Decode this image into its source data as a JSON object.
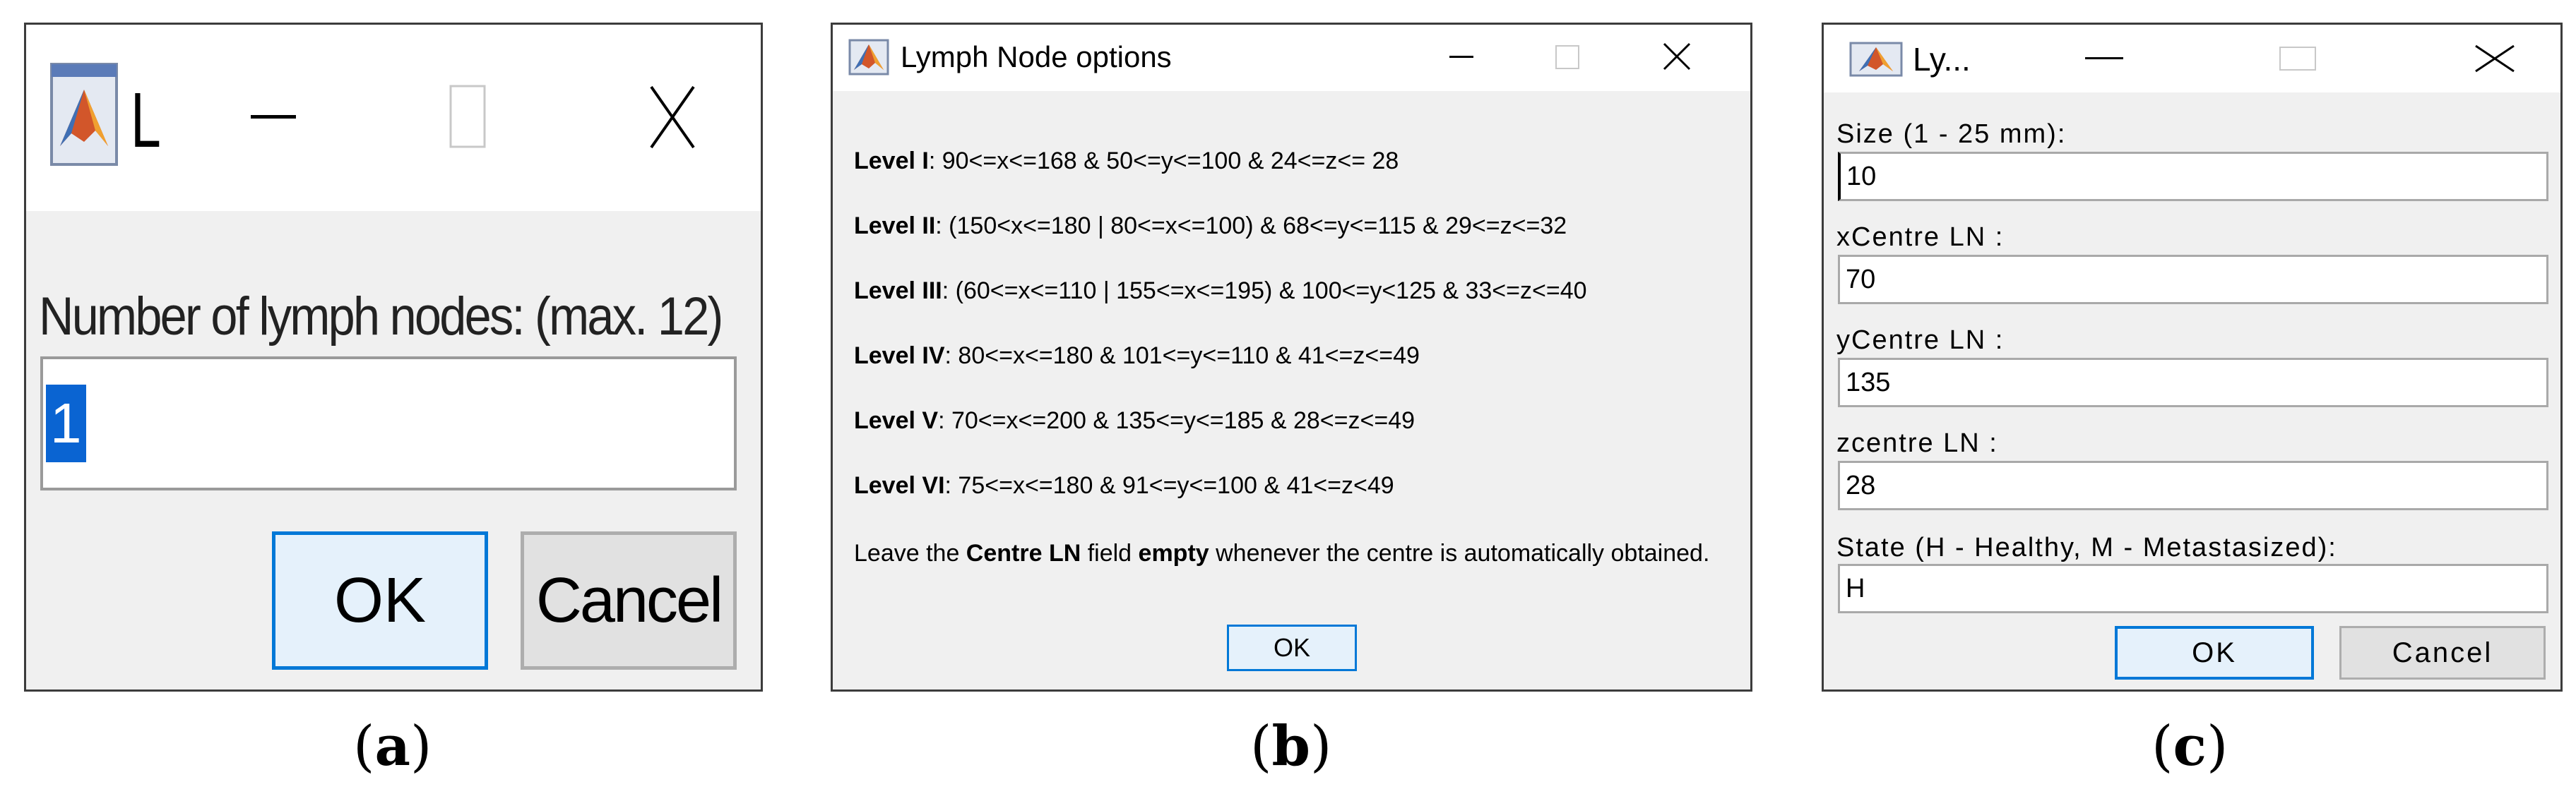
{
  "panel_a": {
    "title": "L",
    "prompt": "Number of lymph nodes: (max. 12)",
    "input_value": "1",
    "ok_label": "OK",
    "cancel_label": "Cancel",
    "caption": "a"
  },
  "panel_b": {
    "title": "Lymph Node options",
    "levels": [
      {
        "name": "Level I",
        "rule": ": 90<=x<=168 & 50<=y<=100 & 24<=z<= 28"
      },
      {
        "name": "Level II",
        "rule": ": (150<x<=180 | 80<=x<=100) & 68<=y<=115 & 29<=z<=32"
      },
      {
        "name": "Level III",
        "rule": ": (60<=x<=110 | 155<=x<=195) & 100<=y<125 & 33<=z<=40"
      },
      {
        "name": "Level IV",
        "rule": ": 80<=x<=180 & 101<=y<=110 & 41<=z<=49"
      },
      {
        "name": "Level V",
        "rule": ": 70<=x<=200 & 135<=y<=185 & 28<=z<=49"
      },
      {
        "name": "Level VI",
        "rule": ": 75<=x<=180 & 91<=y<=100 & 41<=z<49"
      }
    ],
    "note_pre": "Leave the ",
    "note_bold1": "Centre LN",
    "note_mid": " field ",
    "note_bold2": "empty",
    "note_post": " whenever the centre is automatically obtained.",
    "ok_label": "OK",
    "caption": "b"
  },
  "panel_c": {
    "title": "Ly...",
    "fields": [
      {
        "label": "Size (1 - 25 mm):",
        "value": "10"
      },
      {
        "label": "xCentre LN :",
        "value": "70"
      },
      {
        "label": "yCentre LN :",
        "value": "135"
      },
      {
        "label": "zcentre LN :",
        "value": "28"
      },
      {
        "label": "State (H - Healthy, M - Metastasized):",
        "value": "H"
      }
    ],
    "ok_label": "OK",
    "cancel_label": "Cancel",
    "caption": "c"
  },
  "icons": {
    "app": "matlab-icon",
    "minimize": "minimize-icon",
    "maximize": "maximize-icon",
    "close": "close-icon"
  },
  "colors": {
    "accent": "#0078d7",
    "selection": "#0a64d2",
    "dialog_bg": "#f0f0f0"
  }
}
